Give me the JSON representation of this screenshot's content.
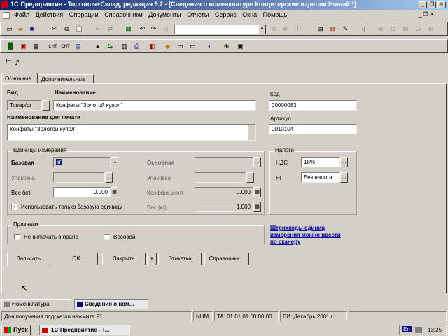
{
  "window": {
    "title": "1С:Предприятие - Торговля+Склад, редакция 9.2 - [Сведения о номенклатуре Кондитерские изделия Новый *]",
    "controls": [
      "minimize",
      "restore",
      "close"
    ]
  },
  "menu": [
    "Файл",
    "Действия",
    "Операции",
    "Справочники",
    "Документы",
    "Отчеты",
    "Сервис",
    "Окна",
    "Помощь"
  ],
  "tabs": [
    "Основные",
    "Дополнительные"
  ],
  "form": {
    "vid_label": "Вид",
    "vid_value": "Товар/ф",
    "name_label": "Наименование",
    "name_value": "Конфеты \"Золотой купол\"",
    "code_label": "Код",
    "code_value": "00000083",
    "fullname_label": "Наименование для печати",
    "fullname_value": "Конфеты \"Золотой купол\"",
    "article_label": "Артикул",
    "article_value": "0010104"
  },
  "units": {
    "title": "Единицы измерения",
    "base_label": "Базовая",
    "base_value": "кг",
    "main_label": "Основная",
    "packing_label": "Упаковка",
    "packing2_label": "Упаковка",
    "weight_label": "Вес (кг)",
    "weight_value": "0.000",
    "coef_label": "Коэффициент",
    "coef_value": "0.000",
    "weight2_label": "Вес (кг)",
    "weight2_value": "1.000",
    "only_base_label": "Использовать только базовую единицу"
  },
  "taxes": {
    "title": "Налоги",
    "vat_label": "НДС",
    "vat_value": "18%",
    "sales_label": "НП",
    "sales_value": "Без налога"
  },
  "flags": {
    "title": "Признаки",
    "exclude_label": "Не включать в прайс",
    "weight_label": "Весовой"
  },
  "link_text": "Штрихкоды единиц измерения можно ввести по сканеру",
  "buttons": {
    "record": "Записать",
    "ok": "OK",
    "close": "Закрыть",
    "labels": "Этикетка",
    "reference": "Справочник..."
  },
  "taskbar_windows": [
    "Номенклатура",
    "Сведения о ном..."
  ],
  "status": {
    "hint": "Для получения подсказки нажмите F1",
    "mode": "NUM",
    "date": "TA: 01.01.01 00:00:00",
    "period": "БИ: Декабрь 2001 г."
  },
  "os_taskbar": {
    "start": "Пуск",
    "app": "1С:Предприятие - Т...",
    "lang": "En",
    "clock": "13:25"
  },
  "colors": {
    "title_bar": "#0a246a",
    "title_bar_end": "#a6caf0",
    "link": "#0000a0",
    "selection": "#0a246a"
  }
}
